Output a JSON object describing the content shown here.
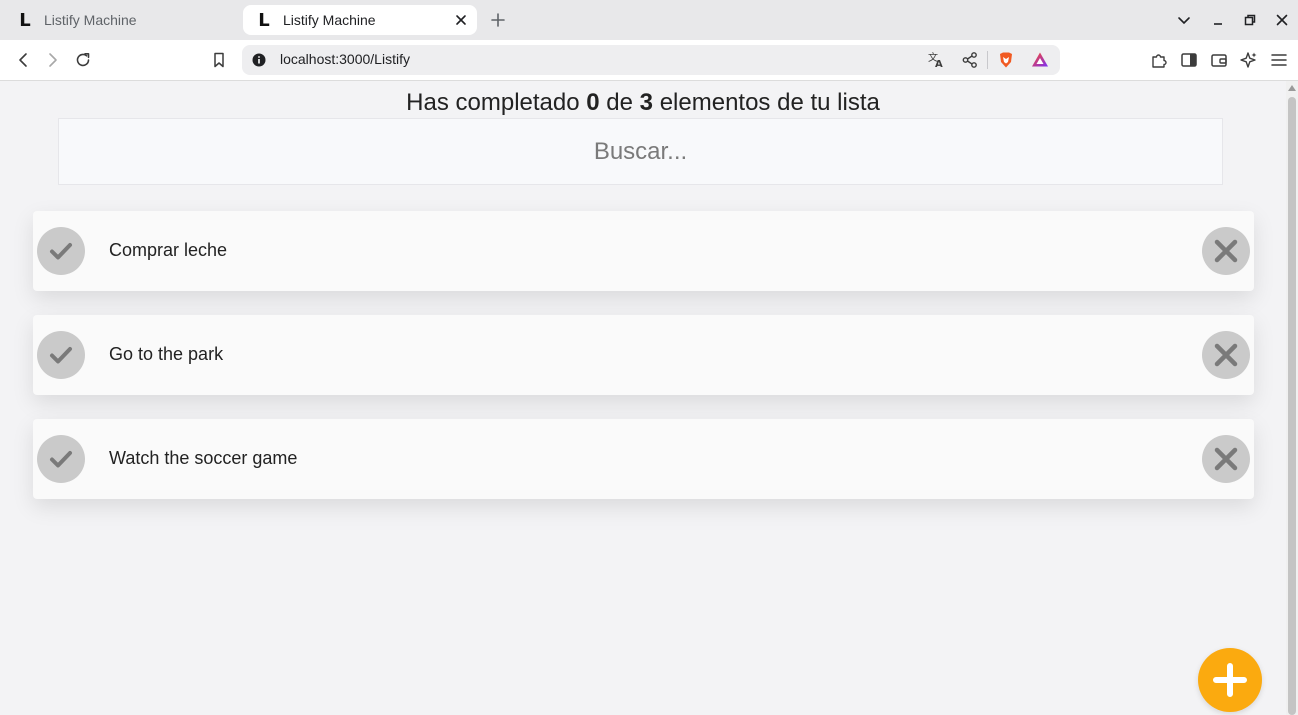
{
  "browser": {
    "tabs": [
      {
        "favicon": "L",
        "title": "Listify Machine",
        "active": false
      },
      {
        "favicon": "L",
        "title": "Listify Machine",
        "active": true
      }
    ],
    "url": "localhost:3000/Listify"
  },
  "app": {
    "counter": {
      "prefix": "Has completado",
      "completed": "0",
      "middle": "de",
      "total": "3",
      "suffix": "elementos de tu lista"
    },
    "search": {
      "placeholder": "Buscar...",
      "value": ""
    },
    "todos": [
      {
        "text": "Comprar leche",
        "completed": false
      },
      {
        "text": "Go to the park",
        "completed": false
      },
      {
        "text": "Watch the soccer game",
        "completed": false
      }
    ]
  },
  "colors": {
    "accent": "#fbaa0f",
    "icon_circle": "#cacaca",
    "icon_glyph": "#7a7a7a",
    "page_background": "#f3f3f5",
    "item_background": "#fafafa"
  },
  "icons": [
    "tab-favicon-l",
    "close-icon",
    "plus-icon",
    "chevron-down-icon",
    "minimize-icon",
    "restore-icon",
    "back-icon",
    "forward-icon",
    "reload-icon",
    "bookmark-icon",
    "info-icon",
    "translate-icon",
    "share-icon",
    "brave-shield-icon",
    "brave-rewards-icon",
    "extensions-icon",
    "sidebar-icon",
    "wallet-icon",
    "leo-ai-icon",
    "menu-icon",
    "check-icon",
    "delete-x-icon",
    "add-plus-icon"
  ]
}
